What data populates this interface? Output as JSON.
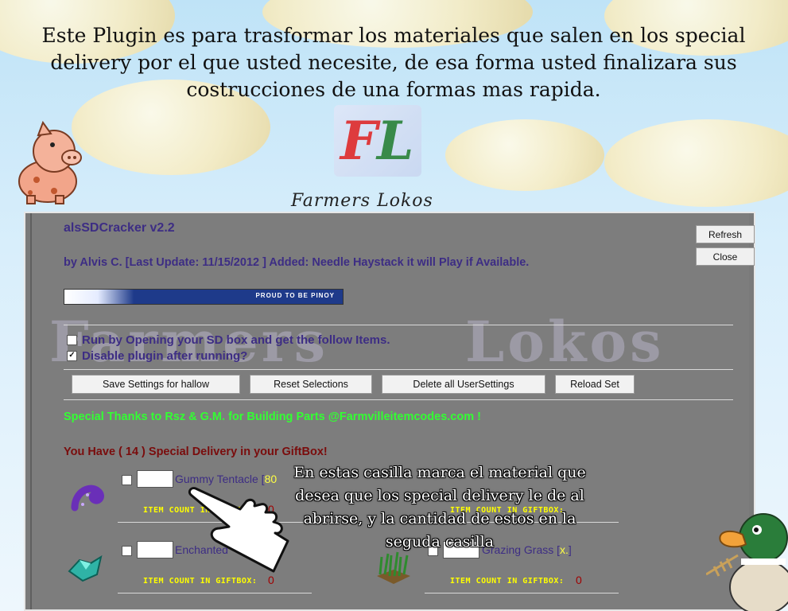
{
  "header": {
    "text": "Este Plugin es para  trasformar los materiales que salen en los  special delivery por el que usted necesite, de esa forma usted finalizara sus costrucciones de una formas mas rapida.",
    "brand": "Farmers Lokos",
    "logo_letters": [
      "F",
      "L"
    ],
    "watermark": [
      "Farmers",
      "Lokos"
    ]
  },
  "window": {
    "title": "alsSDCracker v2.2",
    "byline": "by Alvis C. [Last Update: 11/15/2012 ] Added: Needle Haystack it will Play if Available.",
    "refresh_label": "Refresh",
    "close_label": "Close",
    "banner_text": "PROUD TO BE PINOY"
  },
  "options": [
    {
      "label": "Run by Opening your SD box and get the follow Items.",
      "checked": false
    },
    {
      "label": "Disable plugin after running?",
      "checked": true
    }
  ],
  "buttons": {
    "save": "Save Settings for hallow",
    "reset": "Reset Selections",
    "delete": "Delete all UserSettings",
    "reload": "Reload Set"
  },
  "thanks": "Special Thanks to Rsz & G.M. for Building Parts @Farmvilleitemcodes.com !",
  "have_text": "You Have ( 14 ) Special Delivery in your GiftBox!",
  "items": [
    {
      "name": "Gummy Tentacle",
      "tag": "80",
      "count_label": "ITEM COUNT IN GIFTBOX:",
      "count": "0",
      "icon": "tentacle-icon"
    },
    {
      "name": "",
      "tag": "",
      "count_label": "ITEM COUNT IN GIFTBOX:",
      "count": "",
      "icon": ""
    },
    {
      "name": "Enchanted",
      "tag": "",
      "count_label": "ITEM COUNT IN GIFTBOX:",
      "count": "0",
      "icon": "crystal-icon"
    },
    {
      "name": "Grazing Grass",
      "tag": "x.",
      "count_label": "ITEM COUNT IN GIFTBOX:",
      "count": "0",
      "icon": "grass-icon"
    }
  ],
  "overlay_text": "En estas casilla marca el material que desea que los  special delivery le de al abrirse, y la cantidad de estos en la seguda casilla",
  "colors": {
    "title": "#3d2d84",
    "thanks": "#33ff33",
    "have": "#7a0c0c",
    "count_label": "#ffff00",
    "count_val": "#a00000"
  }
}
